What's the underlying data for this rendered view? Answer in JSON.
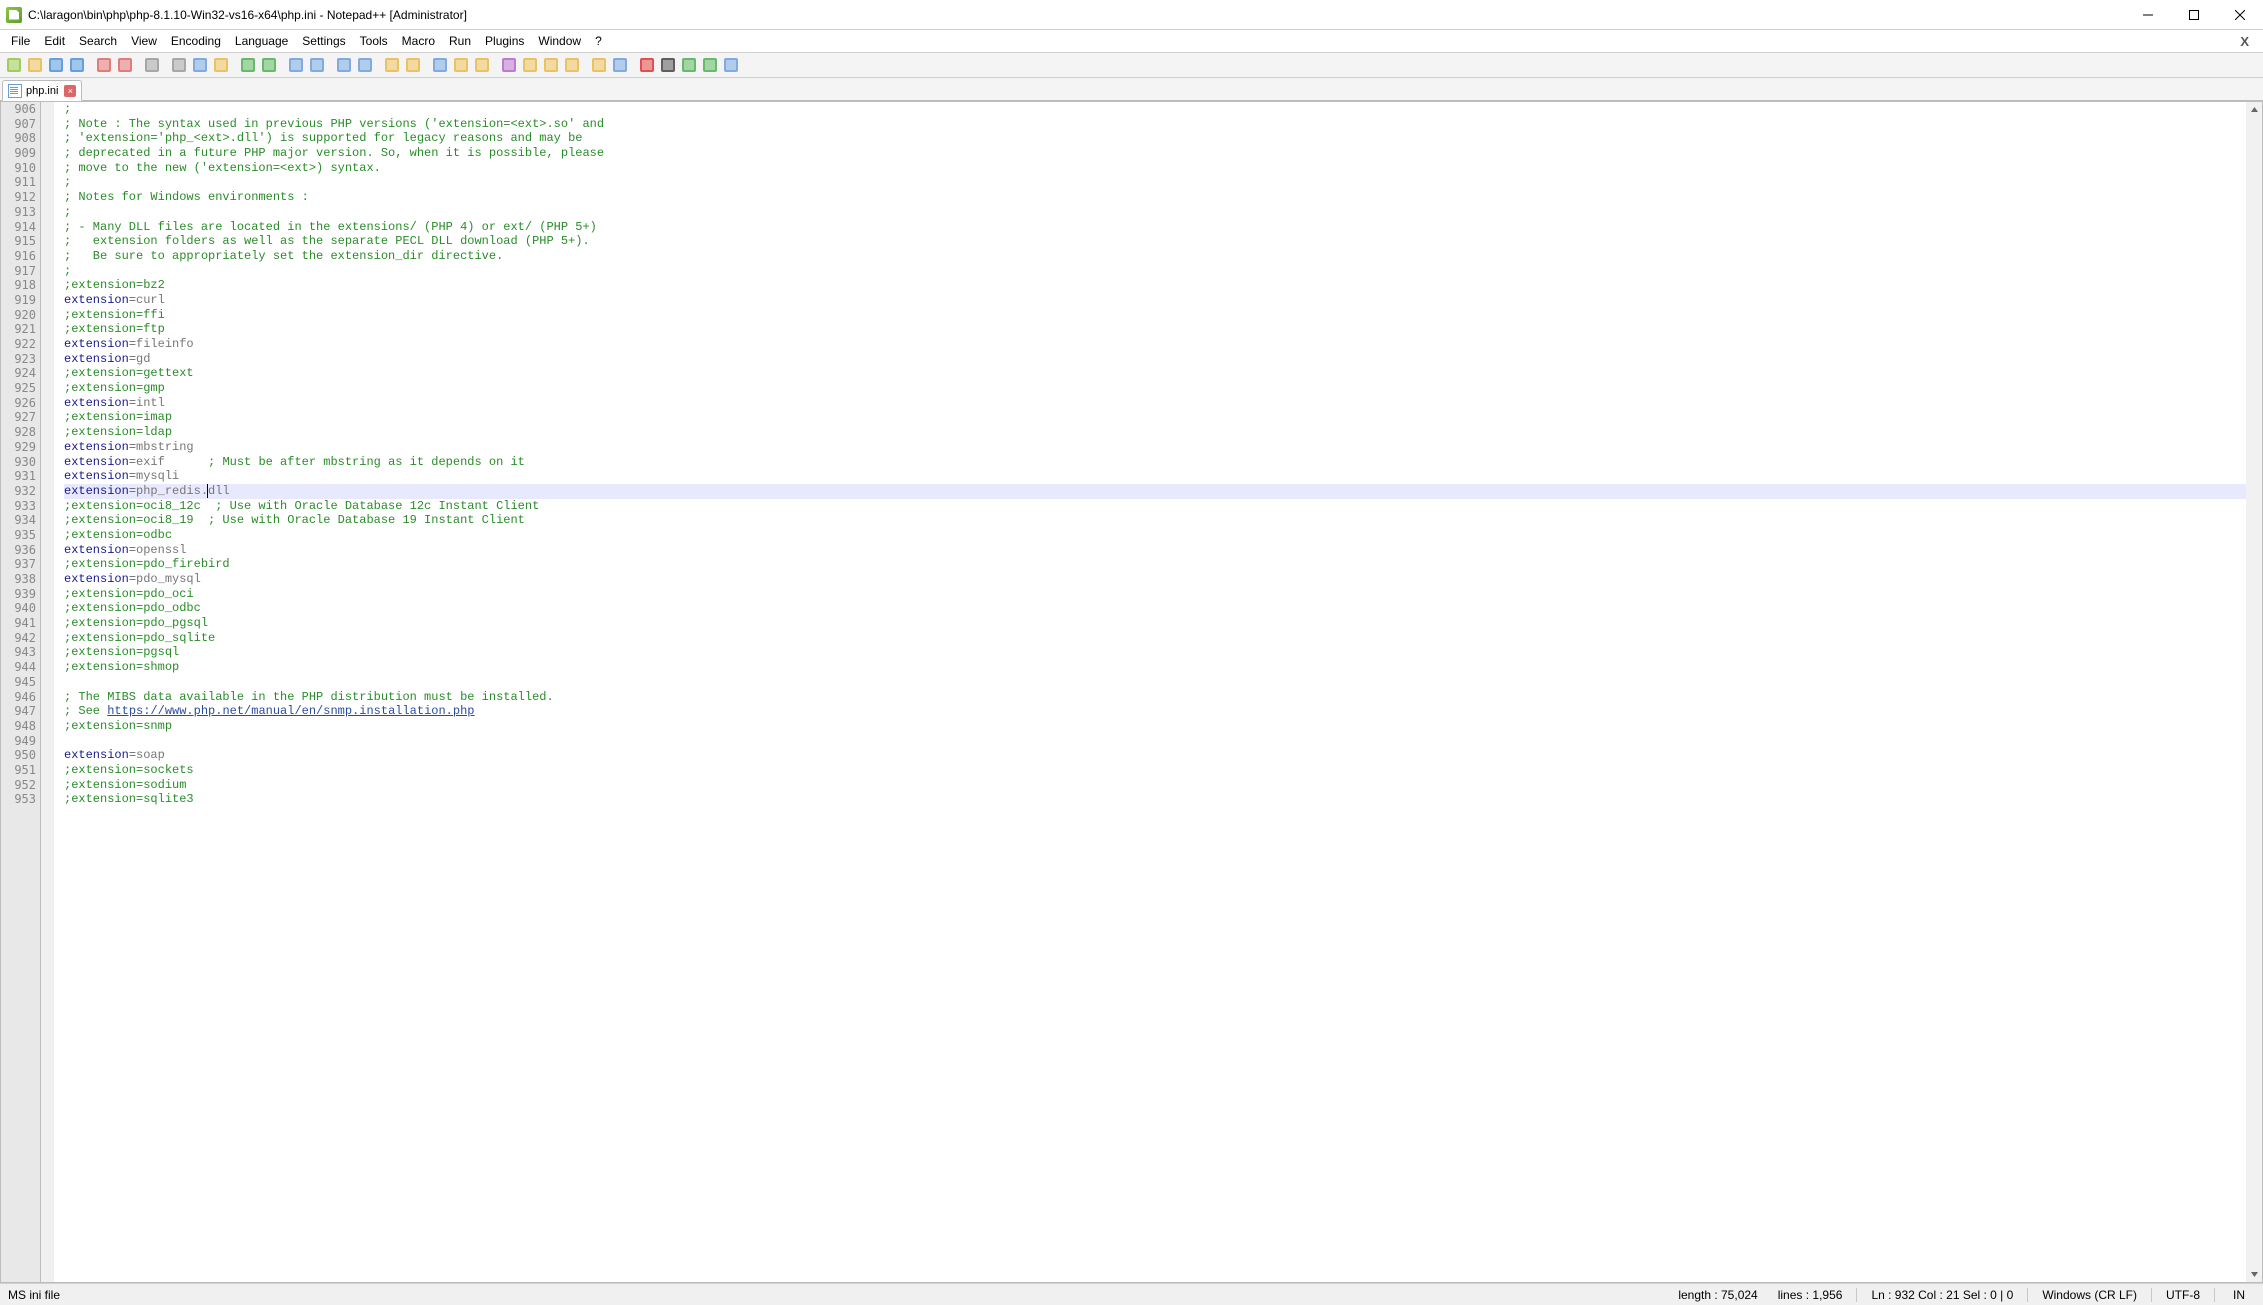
{
  "window": {
    "title": "C:\\laragon\\bin\\php\\php-8.1.10-Win32-vs16-x64\\php.ini - Notepad++ [Administrator]"
  },
  "menu": [
    "File",
    "Edit",
    "Search",
    "View",
    "Encoding",
    "Language",
    "Settings",
    "Tools",
    "Macro",
    "Run",
    "Plugins",
    "Window",
    "?"
  ],
  "toolbar_icons": [
    "new-file",
    "open-file",
    "save",
    "save-all",
    "_sep",
    "close",
    "close-all",
    "_sep",
    "print",
    "_sep",
    "cut",
    "copy",
    "paste",
    "_sep",
    "undo",
    "redo",
    "_sep",
    "find",
    "replace",
    "_sep",
    "zoom-in",
    "zoom-out",
    "_sep",
    "sync-v",
    "sync-h",
    "_sep",
    "word-wrap",
    "show-all",
    "indent-guide",
    "_sep",
    "udlang",
    "doc-map",
    "doc-list",
    "func-list",
    "_sep",
    "folder-workspace",
    "monitor",
    "_sep",
    "record-macro",
    "stop-macro",
    "play-macro",
    "play-macro-multi",
    "save-macro"
  ],
  "tab": {
    "label": "php.ini"
  },
  "line_start": 906,
  "current_line_index": 26,
  "lines": [
    {
      "t": "comment",
      "s": ";"
    },
    {
      "t": "comment",
      "s": "; Note : The syntax used in previous PHP versions ('extension=<ext>.so' and"
    },
    {
      "t": "comment",
      "s": "; 'extension='php_<ext>.dll') is supported for legacy reasons and may be"
    },
    {
      "t": "comment",
      "s": "; deprecated in a future PHP major version. So, when it is possible, please"
    },
    {
      "t": "comment",
      "s": "; move to the new ('extension=<ext>) syntax."
    },
    {
      "t": "comment",
      "s": ";"
    },
    {
      "t": "comment",
      "s": "; Notes for Windows environments :"
    },
    {
      "t": "comment",
      "s": ";"
    },
    {
      "t": "comment",
      "s": "; - Many DLL files are located in the extensions/ (PHP 4) or ext/ (PHP 5+)"
    },
    {
      "t": "comment",
      "s": ";   extension folders as well as the separate PECL DLL download (PHP 5+)."
    },
    {
      "t": "comment",
      "s": ";   Be sure to appropriately set the extension_dir directive."
    },
    {
      "t": "comment",
      "s": ";"
    },
    {
      "t": "comment",
      "s": ";extension=bz2"
    },
    {
      "t": "kv",
      "k": "extension",
      "v": "curl"
    },
    {
      "t": "comment",
      "s": ";extension=ffi"
    },
    {
      "t": "comment",
      "s": ";extension=ftp"
    },
    {
      "t": "kv",
      "k": "extension",
      "v": "fileinfo"
    },
    {
      "t": "kv",
      "k": "extension",
      "v": "gd"
    },
    {
      "t": "comment",
      "s": ";extension=gettext"
    },
    {
      "t": "comment",
      "s": ";extension=gmp"
    },
    {
      "t": "kv",
      "k": "extension",
      "v": "intl"
    },
    {
      "t": "comment",
      "s": ";extension=imap"
    },
    {
      "t": "comment",
      "s": ";extension=ldap"
    },
    {
      "t": "kv",
      "k": "extension",
      "v": "mbstring"
    },
    {
      "t": "kv",
      "k": "extension",
      "v": "exif",
      "trail": "      ; Must be after mbstring as it depends on it"
    },
    {
      "t": "kv",
      "k": "extension",
      "v": "mysqli"
    },
    {
      "t": "kv",
      "k": "extension",
      "v": "php_redis.dll",
      "caret": 20
    },
    {
      "t": "comment",
      "s": ";extension=oci8_12c  ; Use with Oracle Database 12c Instant Client"
    },
    {
      "t": "comment",
      "s": ";extension=oci8_19  ; Use with Oracle Database 19 Instant Client"
    },
    {
      "t": "comment",
      "s": ";extension=odbc"
    },
    {
      "t": "kv",
      "k": "extension",
      "v": "openssl"
    },
    {
      "t": "comment",
      "s": ";extension=pdo_firebird"
    },
    {
      "t": "kv",
      "k": "extension",
      "v": "pdo_mysql"
    },
    {
      "t": "comment",
      "s": ";extension=pdo_oci"
    },
    {
      "t": "comment",
      "s": ";extension=pdo_odbc"
    },
    {
      "t": "comment",
      "s": ";extension=pdo_pgsql"
    },
    {
      "t": "comment",
      "s": ";extension=pdo_sqlite"
    },
    {
      "t": "comment",
      "s": ";extension=pgsql"
    },
    {
      "t": "comment",
      "s": ";extension=shmop"
    },
    {
      "t": "blank",
      "s": ""
    },
    {
      "t": "comment",
      "s": "; The MIBS data available in the PHP distribution must be installed."
    },
    {
      "t": "link",
      "pre": "; See ",
      "url": "https://www.php.net/manual/en/snmp.installation.php"
    },
    {
      "t": "comment",
      "s": ";extension=snmp"
    },
    {
      "t": "blank",
      "s": ""
    },
    {
      "t": "kv",
      "k": "extension",
      "v": "soap"
    },
    {
      "t": "comment",
      "s": ";extension=sockets"
    },
    {
      "t": "comment",
      "s": ";extension=sodium"
    },
    {
      "t": "comment",
      "s": ";extension=sqlite3"
    }
  ],
  "status": {
    "file_type": "MS ini file",
    "length_label": "length : 75,024",
    "lines_label": "lines : 1,956",
    "pos_label": "Ln : 932   Col : 21   Sel : 0 | 0",
    "eol": "Windows (CR LF)",
    "encoding": "UTF-8",
    "ins": "IN"
  }
}
